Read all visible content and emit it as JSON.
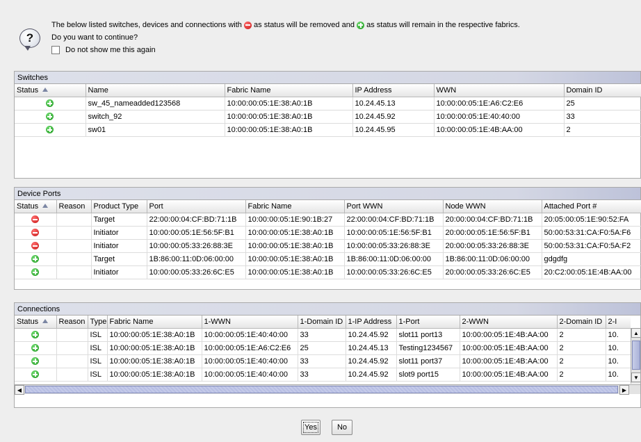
{
  "header": {
    "message_part1": "The below listed switches, devices and connections with",
    "message_part2": "as status will be removed and",
    "message_part3": "as status will remain in the respective fabrics.",
    "question": "Do you want to continue?",
    "dont_show_label": "Do not show me this again",
    "dont_show_checked": false
  },
  "switches": {
    "title": "Switches",
    "columns": [
      "Status",
      "Name",
      "Fabric Name",
      "IP Address",
      "WWN",
      "Domain ID"
    ],
    "rows": [
      {
        "status": "remain",
        "cells": [
          "sw_45_nameadded123568",
          "10:00:00:05:1E:38:A0:1B",
          "10.24.45.13",
          "10:00:00:05:1E:A6:C2:E6",
          "25"
        ]
      },
      {
        "status": "remain",
        "cells": [
          "switch_92",
          "10:00:00:05:1E:38:A0:1B",
          "10.24.45.92",
          "10:00:00:05:1E:40:40:00",
          "33"
        ]
      },
      {
        "status": "remain",
        "cells": [
          "sw01",
          "10:00:00:05:1E:38:A0:1B",
          "10.24.45.95",
          "10:00:00:05:1E:4B:AA:00",
          "2"
        ]
      }
    ]
  },
  "device_ports": {
    "title": "Device Ports",
    "columns": [
      "Status",
      "Reason",
      "Product Type",
      "Port",
      "Fabric Name",
      "Port WWN",
      "Node WWN",
      "Attached Port #"
    ],
    "rows": [
      {
        "status": "removed",
        "cells": [
          "",
          "Target",
          "22:00:00:04:CF:BD:71:1B",
          "10:00:00:05:1E:90:1B:27",
          "22:00:00:04:CF:BD:71:1B",
          "20:00:00:04:CF:BD:71:1B",
          "20:05:00:05:1E:90:52:FA"
        ]
      },
      {
        "status": "removed",
        "cells": [
          "",
          "Initiator",
          "10:00:00:05:1E:56:5F:B1",
          "10:00:00:05:1E:38:A0:1B",
          "10:00:00:05:1E:56:5F:B1",
          "20:00:00:05:1E:56:5F:B1",
          "50:00:53:31:CA:F0:5A:F6"
        ]
      },
      {
        "status": "removed",
        "cells": [
          "",
          "Initiator",
          "10:00:00:05:33:26:88:3E",
          "10:00:00:05:1E:38:A0:1B",
          "10:00:00:05:33:26:88:3E",
          "20:00:00:05:33:26:88:3E",
          "50:00:53:31:CA:F0:5A:F2"
        ]
      },
      {
        "status": "remain",
        "cells": [
          "",
          "Target",
          "1B:86:00:11:0D:06:00:00",
          "10:00:00:05:1E:38:A0:1B",
          "1B:86:00:11:0D:06:00:00",
          "1B:86:00:11:0D:06:00:00",
          "gdgdfg"
        ]
      },
      {
        "status": "remain",
        "cells": [
          "",
          "Initiator",
          "10:00:00:05:33:26:6C:E5",
          "10:00:00:05:1E:38:A0:1B",
          "10:00:00:05:33:26:6C:E5",
          "20:00:00:05:33:26:6C:E5",
          "20:C2:00:05:1E:4B:AA:00"
        ]
      }
    ]
  },
  "connections": {
    "title": "Connections",
    "columns": [
      "Status",
      "Reason",
      "Type",
      "Fabric Name",
      "1-WWN",
      "1-Domain ID",
      "1-IP Address",
      "1-Port",
      "2-WWN",
      "2-Domain ID",
      "2-I"
    ],
    "rows": [
      {
        "status": "remain",
        "cells": [
          "",
          "ISL",
          "10:00:00:05:1E:38:A0:1B",
          "10:00:00:05:1E:40:40:00",
          "33",
          "10.24.45.92",
          "slot11 port13",
          "10:00:00:05:1E:4B:AA:00",
          "2",
          "10."
        ]
      },
      {
        "status": "remain",
        "cells": [
          "",
          "ISL",
          "10:00:00:05:1E:38:A0:1B",
          "10:00:00:05:1E:A6:C2:E6",
          "25",
          "10.24.45.13",
          "Testing1234567",
          "10:00:00:05:1E:4B:AA:00",
          "2",
          "10."
        ]
      },
      {
        "status": "remain",
        "cells": [
          "",
          "ISL",
          "10:00:00:05:1E:38:A0:1B",
          "10:00:00:05:1E:40:40:00",
          "33",
          "10.24.45.92",
          "slot11 port37",
          "10:00:00:05:1E:4B:AA:00",
          "2",
          "10."
        ]
      },
      {
        "status": "remain",
        "cells": [
          "",
          "ISL",
          "10:00:00:05:1E:38:A0:1B",
          "10:00:00:05:1E:40:40:00",
          "33",
          "10.24.45.92",
          "slot9 port15",
          "10:00:00:05:1E:4B:AA:00",
          "2",
          "10."
        ]
      }
    ]
  },
  "buttons": {
    "yes": "Yes",
    "no": "No"
  },
  "colors": {
    "remain": "#1e9a1e",
    "removed": "#c81818",
    "section_header": "#d4d7e4"
  },
  "icons": {
    "dialog": "question-icon",
    "remain": "green-plus-icon",
    "removed": "red-minus-icon",
    "sort": "sort-ascending-icon"
  }
}
